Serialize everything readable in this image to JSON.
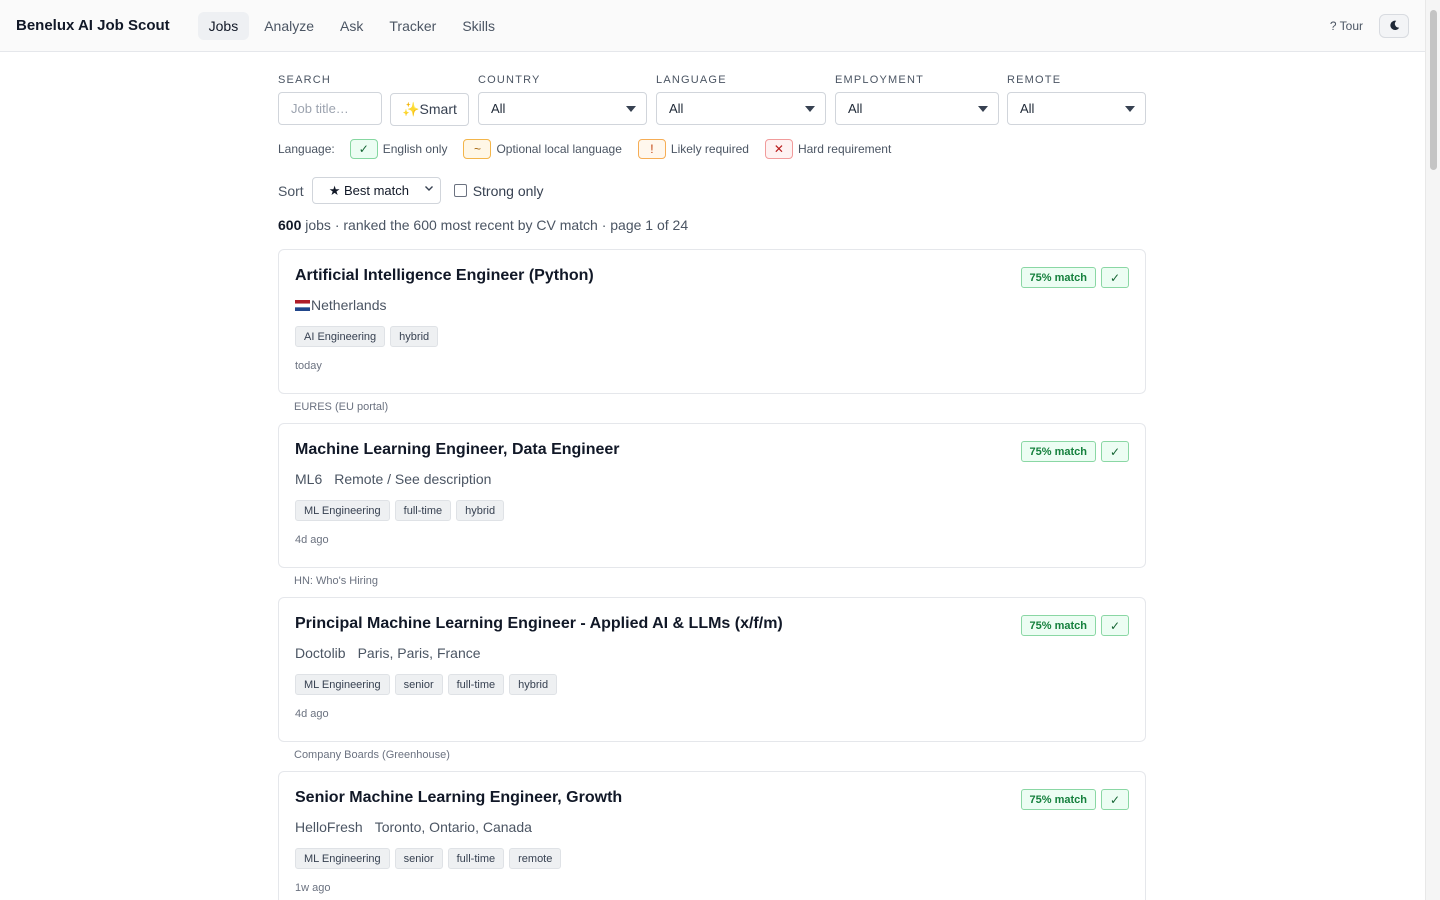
{
  "app": {
    "title": "Benelux AI Job Scout",
    "nav": [
      {
        "label": "Jobs",
        "active": true
      },
      {
        "label": "Analyze",
        "active": false
      },
      {
        "label": "Ask",
        "active": false
      },
      {
        "label": "Tracker",
        "active": false
      },
      {
        "label": "Skills",
        "active": false
      }
    ],
    "tour_label": "? Tour",
    "theme_icon": "moon-icon"
  },
  "filters": {
    "search": {
      "label": "SEARCH",
      "placeholder": "Job title…",
      "value": ""
    },
    "smart_label": "✨Smart",
    "country": {
      "label": "COUNTRY",
      "value": "All"
    },
    "language": {
      "label": "LANGUAGE",
      "value": "All"
    },
    "employment": {
      "label": "EMPLOYMENT",
      "value": "All"
    },
    "remote": {
      "label": "REMOTE",
      "value": "All"
    }
  },
  "legend": {
    "title": "Language:",
    "items": [
      {
        "symbol": "✓",
        "label": "English only",
        "color": "#166534"
      },
      {
        "symbol": "~",
        "label": "Optional local language",
        "color": "#a16207"
      },
      {
        "symbol": "!",
        "label": "Likely required",
        "color": "#c2410c"
      },
      {
        "symbol": "✕",
        "label": "Hard requirement",
        "color": "#b91c1c"
      }
    ]
  },
  "sort": {
    "label": "Sort",
    "value": "★ Best match",
    "strong_only_label": "Strong only",
    "strong_only_checked": false
  },
  "summary": {
    "count": "600",
    "text": " jobs · ranked the 600 most recent by CV match · page 1 of 24"
  },
  "jobs": [
    {
      "title": "Artificial Intelligence Engineer (Python)",
      "company": "",
      "location": "Netherlands",
      "flag": "netherlands-flag-icon",
      "tags": [
        "AI Engineering",
        "hybrid"
      ],
      "posted": "today",
      "match": "75% match",
      "language_status": "✓",
      "source": "EURES (EU portal)"
    },
    {
      "title": "Machine Learning Engineer, Data Engineer",
      "company": "ML6",
      "location": "Remote / See description",
      "flag": "",
      "tags": [
        "ML Engineering",
        "full-time",
        "hybrid"
      ],
      "posted": "4d ago",
      "match": "75% match",
      "language_status": "✓",
      "source": "HN: Who's Hiring"
    },
    {
      "title": "Principal Machine Learning Engineer - Applied AI & LLMs (x/f/m)",
      "company": "Doctolib",
      "location": "Paris, Paris, France",
      "flag": "",
      "tags": [
        "ML Engineering",
        "senior",
        "full-time",
        "hybrid"
      ],
      "posted": "4d ago",
      "match": "75% match",
      "language_status": "✓",
      "source": "Company Boards (Greenhouse)"
    },
    {
      "title": "Senior Machine Learning Engineer, Growth",
      "company": "HelloFresh",
      "location": "Toronto, Ontario, Canada",
      "flag": "",
      "tags": [
        "ML Engineering",
        "senior",
        "full-time",
        "remote"
      ],
      "posted": "1w ago",
      "match": "75% match",
      "language_status": "✓",
      "source": ""
    }
  ]
}
